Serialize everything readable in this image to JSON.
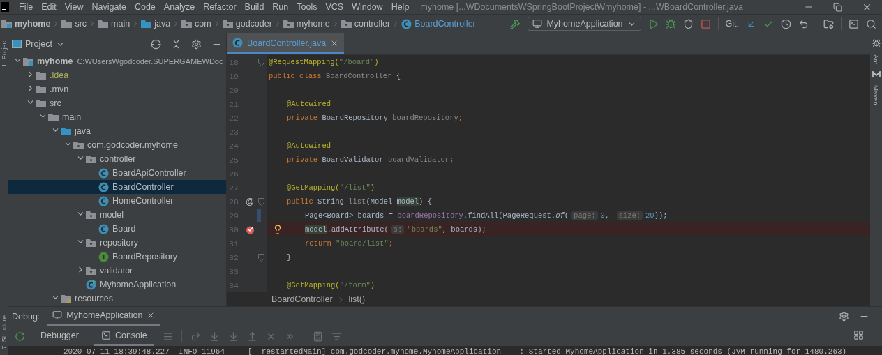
{
  "title_bar": {
    "menus": [
      "File",
      "Edit",
      "View",
      "Navigate",
      "Code",
      "Analyze",
      "Refactor",
      "Build",
      "Run",
      "Tools",
      "VCS",
      "Window",
      "Help"
    ],
    "title": "myhome [...WDocumentsWSpringBootProjectWmyhome] - ...WBoardController.java"
  },
  "nav_bar": {
    "breadcrumbs": [
      {
        "label": "myhome",
        "kind": "module"
      },
      {
        "label": "src",
        "kind": "folder"
      },
      {
        "label": "main",
        "kind": "folder"
      },
      {
        "label": "java",
        "kind": "source"
      },
      {
        "label": "com",
        "kind": "package"
      },
      {
        "label": "godcoder",
        "kind": "package"
      },
      {
        "label": "myhome",
        "kind": "package"
      },
      {
        "label": "controller",
        "kind": "package"
      },
      {
        "label": "BoardController",
        "kind": "class"
      }
    ],
    "run_config": "MyhomeApplication",
    "git_label": "Git:"
  },
  "side_tools": {
    "left": [
      "1: Project",
      "7: Structure"
    ],
    "right": [
      "Ant",
      "Maven"
    ]
  },
  "project_panel": {
    "title": "Project",
    "tree": [
      {
        "label": "myhome",
        "path": "C:WUsersWgodcoder.SUPERGAMEWDoc",
        "kind": "module",
        "expanded": true,
        "selected": false,
        "ignored": false,
        "children": [
          {
            "label": ".idea",
            "kind": "folder",
            "expanded": false,
            "selected": false,
            "ignored": true
          },
          {
            "label": ".mvn",
            "kind": "folder",
            "expanded": false,
            "selected": false,
            "ignored": false
          },
          {
            "label": "src",
            "kind": "folder",
            "expanded": true,
            "selected": false,
            "ignored": false,
            "children": [
              {
                "label": "main",
                "kind": "folder",
                "expanded": true,
                "selected": false,
                "ignored": false,
                "children": [
                  {
                    "label": "java",
                    "kind": "source",
                    "expanded": true,
                    "selected": false,
                    "ignored": false,
                    "children": [
                      {
                        "label": "com.godcoder.myhome",
                        "kind": "package",
                        "expanded": true,
                        "selected": false,
                        "ignored": false,
                        "children": [
                          {
                            "label": "controller",
                            "kind": "package",
                            "expanded": true,
                            "selected": false,
                            "ignored": false,
                            "children": [
                              {
                                "label": "BoardApiController",
                                "kind": "class",
                                "selected": false,
                                "ignored": false
                              },
                              {
                                "label": "BoardController",
                                "kind": "class",
                                "selected": true,
                                "ignored": false
                              },
                              {
                                "label": "HomeController",
                                "kind": "class",
                                "selected": false,
                                "ignored": false
                              }
                            ]
                          },
                          {
                            "label": "model",
                            "kind": "package",
                            "expanded": true,
                            "selected": false,
                            "ignored": false,
                            "children": [
                              {
                                "label": "Board",
                                "kind": "class",
                                "selected": false,
                                "ignored": false
                              }
                            ]
                          },
                          {
                            "label": "repository",
                            "kind": "package",
                            "expanded": true,
                            "selected": false,
                            "ignored": false,
                            "children": [
                              {
                                "label": "BoardRepository",
                                "kind": "interface",
                                "selected": false,
                                "ignored": false
                              }
                            ]
                          },
                          {
                            "label": "validator",
                            "kind": "package",
                            "expanded": false,
                            "selected": false,
                            "ignored": false
                          },
                          {
                            "label": "MyhomeApplication",
                            "kind": "app",
                            "selected": false,
                            "ignored": false
                          }
                        ]
                      }
                    ]
                  },
                  {
                    "label": "resources",
                    "kind": "resources",
                    "expanded": true,
                    "selected": false,
                    "ignored": false
                  }
                ]
              }
            ]
          }
        ]
      }
    ]
  },
  "editor": {
    "tabs": [
      {
        "label": "BoardController.java",
        "selected": true
      }
    ],
    "lines": [
      {
        "number": "18",
        "fold": true,
        "breakpoint": false,
        "bulb": false,
        "changed": false,
        "tokens": [
          {
            "kind": "annotation",
            "text": "@RequestMapping("
          },
          {
            "kind": "string",
            "text": "\"/board\""
          },
          {
            "kind": "annotation",
            "text": ")"
          }
        ]
      },
      {
        "number": "19",
        "fold": false,
        "breakpoint": false,
        "bulb": false,
        "changed": false,
        "tokens": [
          {
            "kind": "keyword",
            "text": "public class "
          },
          {
            "kind": "unused",
            "text": "BoardController"
          },
          {
            "kind": "plain",
            "text": " {"
          }
        ]
      },
      {
        "number": "20",
        "fold": false,
        "breakpoint": false,
        "bulb": false,
        "changed": false
      },
      {
        "number": "21",
        "fold": false,
        "breakpoint": false,
        "bulb": false,
        "changed": false,
        "tokens": [
          {
            "kind": "annotation",
            "text": "@Autowired"
          }
        ]
      },
      {
        "number": "22",
        "fold": false,
        "breakpoint": false,
        "bulb": false,
        "changed": false,
        "tokens": [
          {
            "kind": "keyword",
            "text": "private "
          },
          {
            "kind": "plain",
            "text": "BoardRepository "
          },
          {
            "kind": "unused",
            "text": "boardRepository"
          },
          {
            "kind": "keyword",
            "text": ";"
          }
        ]
      },
      {
        "number": "23",
        "fold": false,
        "breakpoint": false,
        "bulb": false,
        "changed": false
      },
      {
        "number": "24",
        "fold": false,
        "breakpoint": false,
        "bulb": false,
        "changed": false,
        "tokens": [
          {
            "kind": "annotation",
            "text": "@Autowired"
          }
        ]
      },
      {
        "number": "25",
        "fold": false,
        "breakpoint": false,
        "bulb": false,
        "changed": false,
        "tokens": [
          {
            "kind": "keyword",
            "text": "private "
          },
          {
            "kind": "plain",
            "text": "BoardValidator "
          },
          {
            "kind": "unused",
            "text": "boardValidator"
          },
          {
            "kind": "keyword",
            "text": ";"
          }
        ]
      },
      {
        "number": "26",
        "fold": false,
        "breakpoint": false,
        "bulb": false,
        "changed": false
      },
      {
        "number": "27",
        "fold": false,
        "breakpoint": false,
        "bulb": false,
        "changed": false,
        "tokens": [
          {
            "kind": "annotation",
            "text": "@GetMapping("
          },
          {
            "kind": "string",
            "text": "\"/list\""
          },
          {
            "kind": "annotation",
            "text": ")"
          }
        ]
      },
      {
        "number": "28",
        "gutter_text": "@",
        "fold": true,
        "breakpoint": false,
        "bulb": false,
        "changed": false,
        "tokens": [
          {
            "kind": "keyword",
            "text": "public "
          },
          {
            "kind": "plain",
            "text": "String "
          },
          {
            "kind": "unused",
            "text": "list"
          },
          {
            "kind": "plain",
            "text": "(Model "
          },
          {
            "kind": "param",
            "text": "model"
          },
          {
            "kind": "plain",
            "text": ") {"
          }
        ]
      },
      {
        "number": "29",
        "fold": false,
        "breakpoint": false,
        "bulb": false,
        "changed": true,
        "tokens": [
          {
            "kind": "plain",
            "text": "Page<Board> boards = "
          },
          {
            "kind": "field",
            "text": "boardRepository"
          },
          {
            "kind": "plain",
            "text": ".findAll(PageRequest."
          },
          {
            "kind": "static",
            "text": "of"
          },
          {
            "kind": "plain",
            "text": "("
          },
          {
            "kind": "hint",
            "text": "page:"
          },
          {
            "kind": "number",
            "text": "0"
          },
          {
            "kind": "plain",
            "text": ", "
          },
          {
            "kind": "hint",
            "text": "size:"
          },
          {
            "kind": "number",
            "text": "20"
          },
          {
            "kind": "plain",
            "text": "));"
          }
        ]
      },
      {
        "number": "30",
        "fold": false,
        "breakpoint": true,
        "bulb": true,
        "changed": false,
        "tokens": [
          {
            "kind": "param",
            "text": "model"
          },
          {
            "kind": "plain",
            "text": ".addAttribute("
          },
          {
            "kind": "hint",
            "text": "s:"
          },
          {
            "kind": "string",
            "text": "\"boards\""
          },
          {
            "kind": "plain",
            "text": ", boards);"
          }
        ]
      },
      {
        "number": "31",
        "fold": false,
        "breakpoint": false,
        "bulb": false,
        "changed": false,
        "tokens": [
          {
            "kind": "keyword",
            "text": "return "
          },
          {
            "kind": "string",
            "text": "\"board/list\""
          },
          {
            "kind": "keyword",
            "text": ";"
          }
        ]
      },
      {
        "number": "32",
        "fold": true,
        "breakpoint": false,
        "bulb": false,
        "changed": false,
        "tokens": [
          {
            "kind": "plain",
            "text": "}"
          }
        ]
      },
      {
        "number": "33",
        "fold": false,
        "breakpoint": false,
        "bulb": false,
        "changed": false
      },
      {
        "number": "34",
        "fold": false,
        "breakpoint": false,
        "bulb": false,
        "changed": false,
        "tokens": [
          {
            "kind": "annotation",
            "text": "@GetMapping("
          },
          {
            "kind": "string",
            "text": "\"/form\""
          },
          {
            "kind": "annotation",
            "text": ")"
          }
        ]
      }
    ],
    "breadcrumb": [
      "BoardController",
      "list()"
    ]
  },
  "debug": {
    "label": "Debug:",
    "sessions": [
      {
        "label": "MyhomeApplication",
        "selected": true
      }
    ],
    "tabs": [
      {
        "label": "Debugger",
        "selected": false
      },
      {
        "label": "Console",
        "selected": true
      }
    ],
    "console": [
      "2020-07-11 18:39:48.227  INFO 11964 --- [  restartedMain] com.godcoder.myhome.MyhomeApplication    : Started MyhomeApplication in 1.385 seconds (JVM running for 1480.263)"
    ]
  }
}
